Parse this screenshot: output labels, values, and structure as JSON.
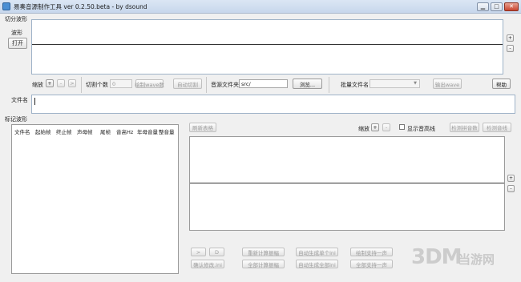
{
  "window": {
    "title": "易奏音源制作工具 ver 0.2.50.beta - by dsound",
    "min": "▁",
    "max": "□",
    "close": "✕"
  },
  "top": {
    "group_label": "切分波形",
    "wave_label": "波形",
    "open_button": "打开",
    "zoom_label": "缩放",
    "zoom_plus": "+",
    "zoom_minus": "-",
    "zoom_right": ">",
    "cut_count_label": "切割个数",
    "cut_count_value": "0",
    "draw_wave_count_button": "绘制wave数",
    "auto_cut_button": "自动切割",
    "source_folder_label": "音源文件夹",
    "source_folder_value": "src/",
    "browse_button": "浏览...",
    "batch_filename_label": "批量文件名",
    "export_wave_button": "输出wave",
    "help_button": "帮助",
    "filename_label": "文件名",
    "side_plus": "+",
    "side_minus": "-"
  },
  "bottom": {
    "group_label": "标记波形",
    "table_headers": [
      "文件名",
      "起始帧",
      "终止帧",
      "声母帧",
      "尾帧",
      "音高Hz",
      "年母音量",
      "整音量"
    ],
    "refresh_table_button": "刷新表格",
    "zoom_label": "缩放",
    "zoom_plus": "+",
    "zoom_minus": "-",
    "show_pitch_label": "显示音高线",
    "detect_frames_button": "检测拼音数",
    "detect_pitch_button": "检测音线",
    "play_button": ">",
    "d_button": "D",
    "confirm_button": "确认修改.ini",
    "recalc_button": "重新计算振幅",
    "all_recalc_button": "全部计算振幅",
    "auto_single_ini_button": "自动生成单个ini",
    "auto_all_ini_button": "自动生成全部ini",
    "draw_one_button": "绘制支持一声",
    "all_one_button": "全部支持一声",
    "side_plus": "+",
    "side_minus": "-"
  },
  "watermark": {
    "logo": "3DM",
    "text": "当游网"
  }
}
